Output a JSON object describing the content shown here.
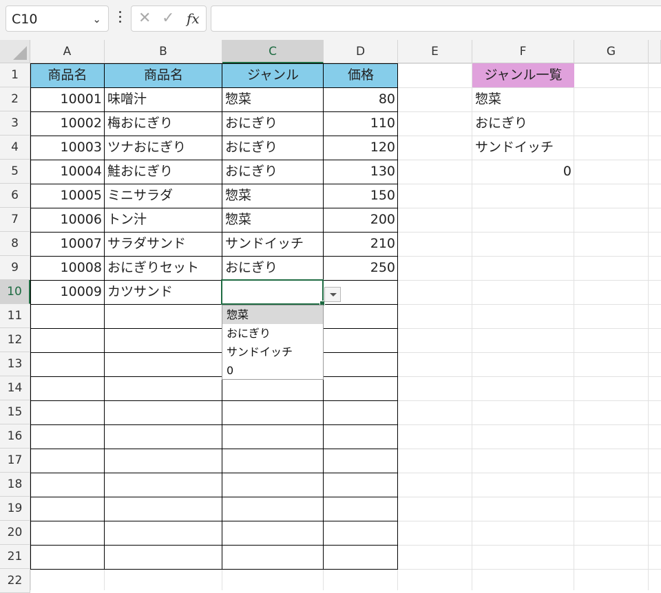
{
  "formula_bar": {
    "name_box": "C10",
    "cancel_glyph": "✕",
    "enter_glyph": "✓",
    "fx_label": "fx",
    "formula": ""
  },
  "columns": [
    "A",
    "B",
    "C",
    "D",
    "E",
    "F",
    "G"
  ],
  "rows": [
    "1",
    "2",
    "3",
    "4",
    "5",
    "6",
    "7",
    "8",
    "9",
    "10",
    "11",
    "12",
    "13",
    "14",
    "15",
    "16",
    "17",
    "18",
    "19",
    "20",
    "21",
    "22"
  ],
  "selected_cell": "C10",
  "table": {
    "headers": [
      "商品名",
      "商品名",
      "ジャンル",
      "価格"
    ],
    "rows": [
      [
        "10001",
        "味噌汁",
        "惣菜",
        "80"
      ],
      [
        "10002",
        "梅おにぎり",
        "おにぎり",
        "110"
      ],
      [
        "10003",
        "ツナおにぎり",
        "おにぎり",
        "120"
      ],
      [
        "10004",
        "鮭おにぎり",
        "おにぎり",
        "130"
      ],
      [
        "10005",
        "ミニサラダ",
        "惣菜",
        "150"
      ],
      [
        "10006",
        "トン汁",
        "惣菜",
        "200"
      ],
      [
        "10007",
        "サラダサンド",
        "サンドイッチ",
        "210"
      ],
      [
        "10008",
        "おにぎりセット",
        "おにぎり",
        "250"
      ],
      [
        "10009",
        "カツサンド",
        "",
        ""
      ]
    ]
  },
  "genre_list": {
    "header": "ジャンル一覧",
    "items": [
      "惣菜",
      "おにぎり",
      "サンドイッチ"
    ],
    "numeric_value": "0"
  },
  "dropdown": {
    "options": [
      "惣菜",
      "おにぎり",
      "サンドイッチ",
      "0"
    ],
    "highlighted_index": 0
  },
  "colors": {
    "header_fill": "#86cdea",
    "genre_header_fill": "#e0a1dc",
    "selection_green": "#1e6b42"
  }
}
